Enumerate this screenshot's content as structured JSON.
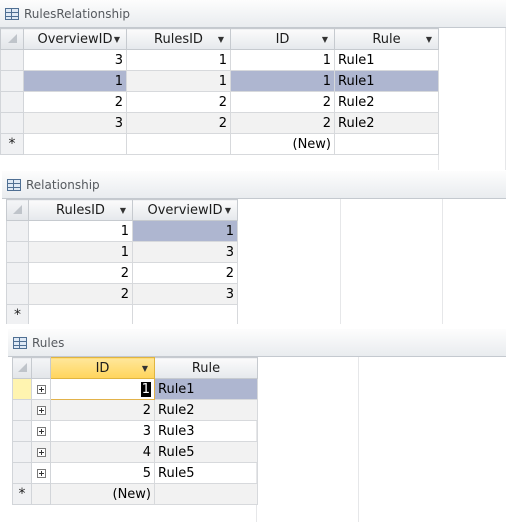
{
  "windows": {
    "rules_relationship": {
      "title": "RulesRelationship",
      "columns": [
        "OverviewID",
        "RulesID",
        "ID",
        "Rule"
      ],
      "rows": [
        [
          "3",
          "1",
          "1",
          "Rule1"
        ],
        [
          "1",
          "1",
          "1",
          "Rule1"
        ],
        [
          "2",
          "2",
          "2",
          "Rule2"
        ],
        [
          "3",
          "2",
          "2",
          "Rule2"
        ]
      ],
      "new_row": {
        "marker": "*",
        "id_placeholder": "(New)"
      }
    },
    "relationship": {
      "title": "Relationship",
      "columns": [
        "RulesID",
        "OverviewID"
      ],
      "rows": [
        [
          "1",
          "1"
        ],
        [
          "1",
          "3"
        ],
        [
          "2",
          "2"
        ],
        [
          "2",
          "3"
        ]
      ],
      "new_row": {
        "marker": "*"
      }
    },
    "rules": {
      "title": "Rules",
      "columns": [
        "ID",
        "Rule"
      ],
      "rows": [
        [
          "1",
          "Rule1"
        ],
        [
          "2",
          "Rule2"
        ],
        [
          "3",
          "Rule3"
        ],
        [
          "4",
          "Rule5"
        ],
        [
          "5",
          "Rule5"
        ]
      ],
      "new_row": {
        "marker": "*",
        "id_placeholder": "(New)"
      }
    }
  },
  "icons": {
    "title_icon": "table-icon",
    "dropdown": "dropdown-arrow-icon",
    "expand": "expand-plus-icon"
  },
  "colors": {
    "selection": "#aeb6d0",
    "active_header": "#ffd45c",
    "alt_row": "#f2f2f2"
  }
}
